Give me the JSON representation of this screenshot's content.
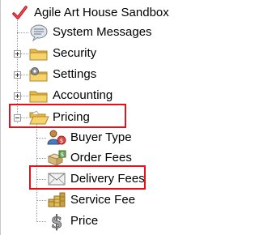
{
  "tree": {
    "root": {
      "label": "Agile Art House Sandbox",
      "icon": "red-check-icon",
      "expanded": true
    },
    "items": [
      {
        "label": "System Messages",
        "icon": "speech-bubble-icon",
        "expander": "none"
      },
      {
        "label": "Security",
        "icon": "folder-icon",
        "expander": "collapsed"
      },
      {
        "label": "Settings",
        "icon": "folder-gear-icon",
        "expander": "collapsed"
      },
      {
        "label": "Accounting",
        "icon": "folder-icon",
        "expander": "collapsed"
      },
      {
        "label": "Pricing",
        "icon": "folder-open-icon",
        "expander": "expanded",
        "highlighted": true
      }
    ],
    "pricing_children": [
      {
        "label": "Buyer Type",
        "icon": "buyer-type-icon"
      },
      {
        "label": "Order Fees",
        "icon": "order-fees-icon"
      },
      {
        "label": "Delivery Fees",
        "icon": "delivery-envelope-icon",
        "highlighted": true
      },
      {
        "label": "Service Fee",
        "icon": "coins-icon"
      },
      {
        "label": "Price",
        "icon": "dollar-sign-icon"
      }
    ]
  },
  "colors": {
    "highlight": "#e0121b",
    "connector": "#9a9a9a",
    "folder": "#f2c94c"
  }
}
